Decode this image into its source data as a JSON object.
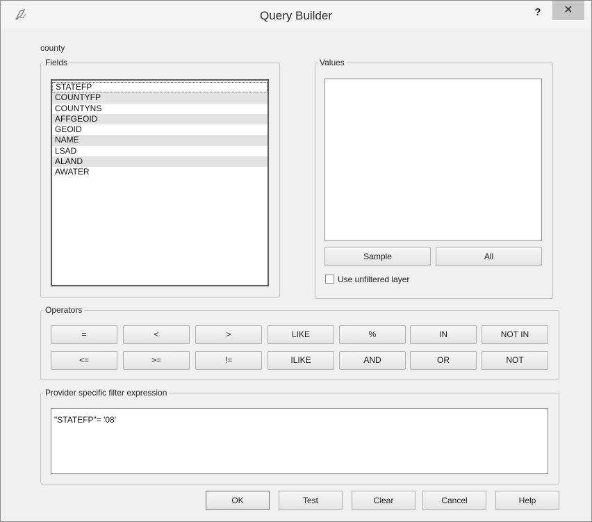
{
  "window": {
    "title": "Query Builder",
    "help_label": "?",
    "close_label": "✕",
    "app_icon": "qgis-icon"
  },
  "layer_name": "county",
  "fields": {
    "legend": "Fields",
    "items": [
      "STATEFP",
      "COUNTYFP",
      "COUNTYNS",
      "AFFGEOID",
      "GEOID",
      "NAME",
      "LSAD",
      "ALAND",
      "AWATER"
    ]
  },
  "values": {
    "legend": "Values",
    "sample_label": "Sample",
    "all_label": "All",
    "unfiltered_label": "Use unfiltered layer",
    "unfiltered_checked": false
  },
  "operators": {
    "legend": "Operators",
    "row1": [
      "=",
      "<",
      ">",
      "LIKE",
      "%",
      "IN",
      "NOT IN"
    ],
    "row2": [
      "<=",
      ">=",
      "!=",
      "ILIKE",
      "AND",
      "OR",
      "NOT"
    ]
  },
  "filter": {
    "legend": "Provider specific filter expression",
    "expression": "\"STATEFP\"= '08'"
  },
  "buttons": {
    "ok": "OK",
    "test": "Test",
    "clear": "Clear",
    "cancel": "Cancel",
    "help": "Help"
  }
}
